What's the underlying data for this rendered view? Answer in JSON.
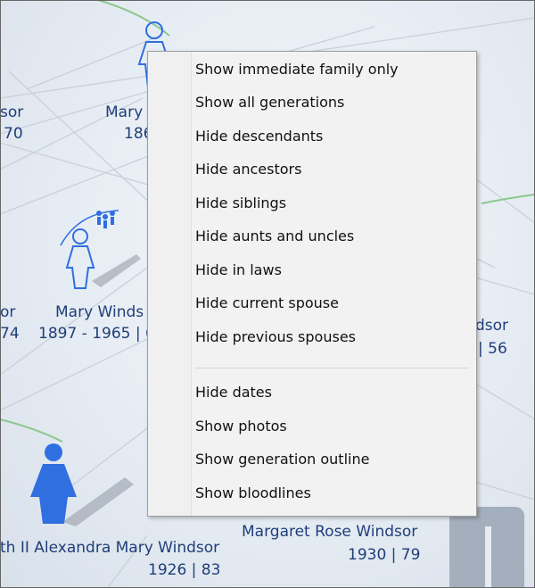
{
  "background": {
    "accent": "#2f6fe0",
    "label_color": "#1f3e7a",
    "people": [
      {
        "name": "sor",
        "dates": "70"
      },
      {
        "name": "Mary",
        "dates": "186"
      },
      {
        "name": "or",
        "dates": "74"
      },
      {
        "name": "Mary Winds",
        "dates": "1897 - 1965 | 6"
      },
      {
        "name": "dsor",
        "dates": "| 56"
      },
      {
        "name": "th II Alexandra Mary Windsor",
        "dates": "1926 | 83"
      },
      {
        "name": "Margaret Rose Windsor",
        "dates": "1930 | 79"
      }
    ]
  },
  "context_menu": {
    "items": [
      "Show immediate family only",
      "Show all generations",
      "Hide descendants",
      "Hide ancestors",
      "Hide siblings",
      "Hide aunts and uncles",
      "Hide in laws",
      "Hide current spouse",
      "Hide previous spouses"
    ],
    "items_2": [
      "Hide dates",
      "Show photos",
      "Show generation outline",
      "Show bloodlines"
    ]
  }
}
